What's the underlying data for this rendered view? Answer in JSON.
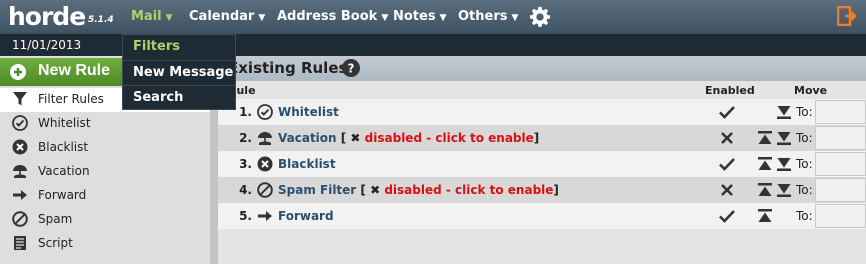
{
  "topbar": {
    "logo": "horde",
    "version": "5.1.4",
    "menus": [
      {
        "label": "Mail",
        "active": true
      },
      {
        "label": "Calendar",
        "active": false
      },
      {
        "label": "Address Book",
        "active": false
      },
      {
        "label": "Notes",
        "active": false
      },
      {
        "label": "Others",
        "active": false
      }
    ],
    "settings_icon": "gear-icon",
    "logout_icon": "exit-icon"
  },
  "date": "11/01/2013",
  "mail_menu": {
    "items": [
      {
        "label": "Filters",
        "active": true
      },
      {
        "label": "New Message",
        "active": false
      },
      {
        "label": "Search",
        "active": false
      }
    ]
  },
  "sidebar": {
    "new_rule": "New Rule",
    "items": [
      {
        "label": "Filter Rules",
        "icon": "filter-icon",
        "selected": true
      },
      {
        "label": "Whitelist",
        "icon": "check-circle-icon"
      },
      {
        "label": "Blacklist",
        "icon": "x-circle-icon"
      },
      {
        "label": "Vacation",
        "icon": "vacation-icon"
      },
      {
        "label": "Forward",
        "icon": "arrow-right-icon"
      },
      {
        "label": "Spam",
        "icon": "no-symbol-icon"
      },
      {
        "label": "Script",
        "icon": "script-icon"
      }
    ]
  },
  "main": {
    "title": "Existing Rules",
    "help_icon": "help-icon",
    "columns": {
      "rule": "Rule",
      "enabled": "Enabled",
      "move": "Move"
    },
    "rules": [
      {
        "num": "1.",
        "name": "Whitelist",
        "icon": "check-circle-icon",
        "enabled": true,
        "disabled_note": "",
        "move_up": false,
        "move_down": true,
        "to_label": "To:"
      },
      {
        "num": "2.",
        "name": "Vacation",
        "icon": "vacation-icon",
        "enabled": false,
        "disabled_note": "disabled - click to enable",
        "move_up": true,
        "move_down": true,
        "to_label": "To:"
      },
      {
        "num": "3.",
        "name": "Blacklist",
        "icon": "x-circle-icon",
        "enabled": true,
        "disabled_note": "",
        "move_up": true,
        "move_down": true,
        "to_label": "To:"
      },
      {
        "num": "4.",
        "name": "Spam Filter",
        "icon": "no-symbol-icon",
        "enabled": false,
        "disabled_note": "disabled - click to enable",
        "move_up": true,
        "move_down": true,
        "to_label": "To:"
      },
      {
        "num": "5.",
        "name": "Forward",
        "icon": "arrow-right-icon",
        "enabled": true,
        "disabled_note": "",
        "move_up": true,
        "move_down": false,
        "to_label": "To:"
      }
    ]
  },
  "colors": {
    "accent": "#a9d26a",
    "disabled": "#d81010",
    "link": "#2a4f6e",
    "new_rule_bg": "#5a9a30"
  }
}
